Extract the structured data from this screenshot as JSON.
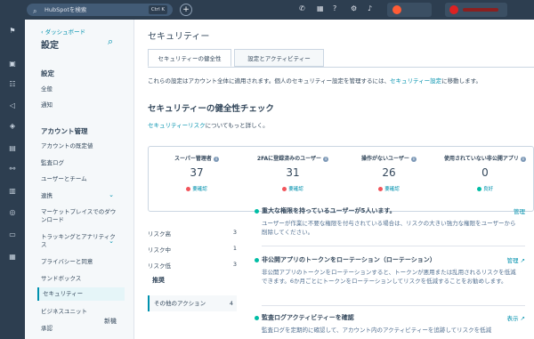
{
  "topbar": {
    "search_placeholder": "HubSpotを検索",
    "search_shortcut": "Ctrl K"
  },
  "settings_nav": {
    "back_label": "ダッシュボード",
    "title": "設定",
    "section_settings": "設定",
    "items_settings": [
      "全般",
      "通知"
    ],
    "section_account": "アカウント管理",
    "items_account": [
      "アカウントの既定値",
      "監査ログ",
      "ユーザーとチーム",
      "連携",
      "マーケットプレイスでのダウンロード",
      "トラッキングとアナリティクス",
      "プライバシーと同意",
      "サンドボックス",
      "セキュリティー",
      "ビジネスユニット",
      "承認"
    ],
    "new_badge": "新機"
  },
  "main": {
    "page_title": "セキュリティー",
    "tabs": [
      "セキュリティーの健全性",
      "設定とアクティビティー"
    ],
    "desc_prefix": "これらの設定はアカウント全体に適用されます。個人のセキュリティー設定を管理するには、",
    "desc_link": "セキュリティー設定",
    "desc_suffix": "に移動します。",
    "health_title": "セキュリティーの健全性チェック",
    "risk_link": "セキュリティーリスク",
    "risk_link_suffix": "についてもっと詳しく。",
    "stats": [
      {
        "label": "スーパー管理者",
        "value": "37",
        "status": "要確認",
        "status_color": "#f2545b"
      },
      {
        "label": "2FAに登録済みのユーザー",
        "value": "31",
        "status": "要確認",
        "status_color": "#f2545b"
      },
      {
        "label": "操作がないユーザー",
        "value": "26",
        "status": "要確認",
        "status_color": "#f2545b"
      },
      {
        "label": "使用されていない非公開アプリ",
        "value": "0",
        "status": "良好",
        "status_color": "#00bda5"
      }
    ],
    "risk_levels": [
      {
        "label": "リスク高",
        "count": "3"
      },
      {
        "label": "リスク中",
        "count": "1"
      },
      {
        "label": "リスク低",
        "count": "3"
      }
    ],
    "recommended_title": "推奨",
    "recommended_item": {
      "label": "その他のアクション",
      "count": "4"
    },
    "recommendations": [
      {
        "title": "重大な権限を持っているユーザーが5人います。",
        "action": "管理",
        "desc": "ユーザーが作業に不要な権限を付与されている場合は、リスクの大きい強力な権限をユーザーから削除してください。"
      },
      {
        "title": "非公開アプリのトークンをローテーション（ローテーション）",
        "action": "管理",
        "desc": "非公開アプリのトークンをローテーションすると、トークンが悪用または乱用されるリスクを低減できます。6か月ごとにトークンをローテーションしてリスクを低減することをお勧めします。"
      },
      {
        "title": "監査ログアクティビティーを確認",
        "action": "表示",
        "desc": "監査ログを定期的に確認して、アカウント内のアクティビティーを追跡してリスクを低減"
      }
    ]
  }
}
